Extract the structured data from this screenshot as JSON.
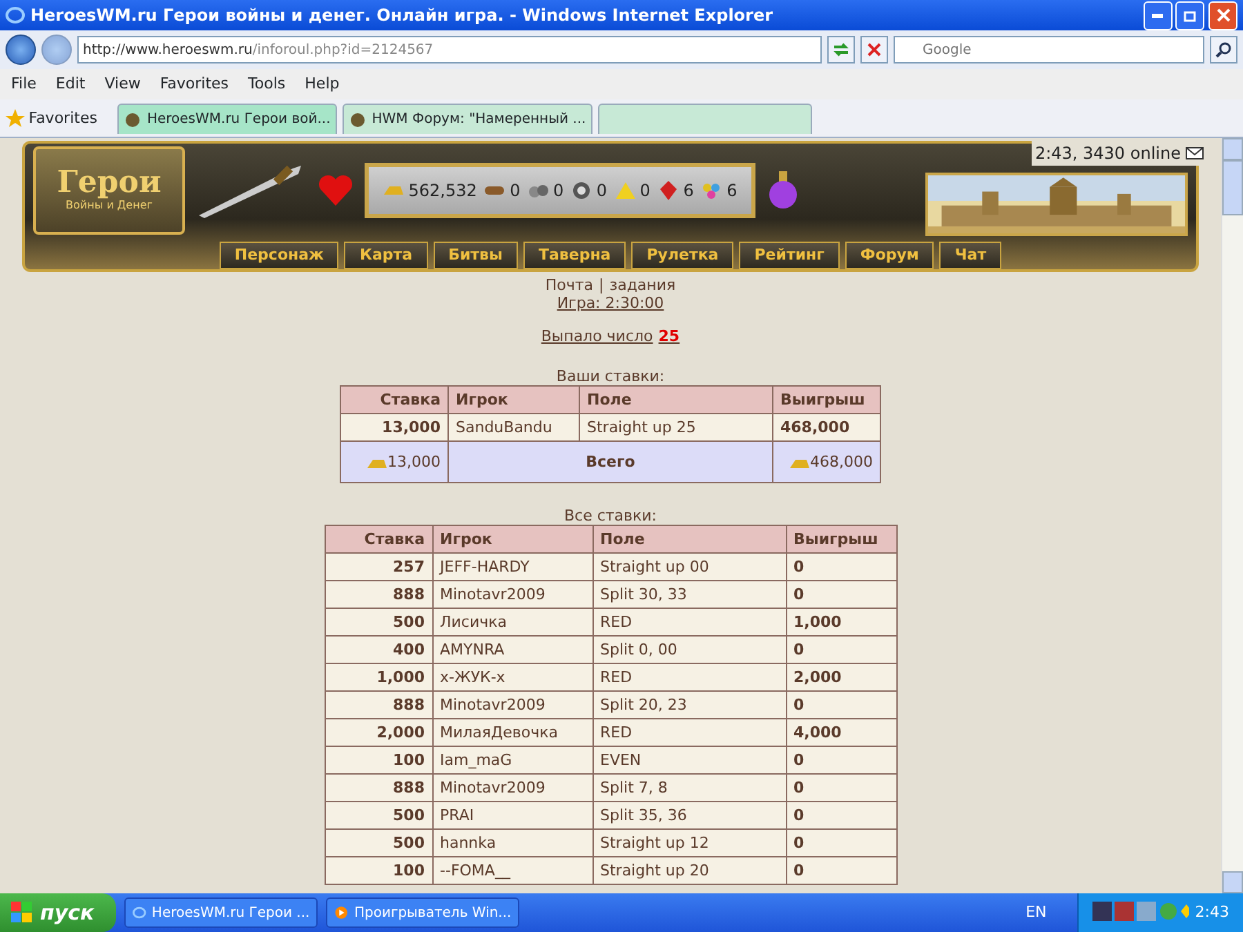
{
  "browser": {
    "title": "HeroesWM.ru Герои войны и денег. Онлайн игра. - Windows Internet Explorer",
    "address_host": "http://www.heroeswm.ru",
    "address_path": "/inforoul.php?id=2124567",
    "search_placeholder": "Google",
    "menu": [
      "File",
      "Edit",
      "View",
      "Favorites",
      "Tools",
      "Help"
    ],
    "favorites_label": "Favorites",
    "tabs": [
      {
        "label": "HeroesWM.ru Герои вой...",
        "selected": true
      },
      {
        "label": "HWM Форум: \"Намеренный ...",
        "selected": false
      }
    ]
  },
  "header": {
    "logo_title": "Герои",
    "logo_subtitle": "Войны и Денег",
    "online": "2:43, 3430 online",
    "resources": [
      {
        "kind": "gold",
        "value": "562,532"
      },
      {
        "kind": "wood",
        "value": "0"
      },
      {
        "kind": "ore",
        "value": "0"
      },
      {
        "kind": "mercury",
        "value": "0"
      },
      {
        "kind": "sulfur",
        "value": "0"
      },
      {
        "kind": "crystal",
        "value": "6"
      },
      {
        "kind": "gems",
        "value": "6"
      }
    ],
    "nav": [
      "Персонаж",
      "Карта",
      "Битвы",
      "Таверна",
      "Рулетка",
      "Рейтинг",
      "Форум",
      "Чат"
    ]
  },
  "links": {
    "mail": "Почта",
    "separator": "|",
    "tasks": "задания",
    "game": "Игра: 2:30:00"
  },
  "result": "Выпало число **25**",
  "my_bets": {
    "caption": "Ваши ставки:",
    "columns": [
      "Ставка",
      "Игрок",
      "Поле",
      "Выигрыш"
    ],
    "rows": [
      [
        "13,000",
        "SanduBandu",
        "Straight up 25",
        "468,000"
      ]
    ],
    "total": {
      "stake": "13,000",
      "label": "Всего",
      "win": "468,000"
    }
  },
  "all_bets": {
    "caption": "Все ставки:",
    "columns": [
      "Ставка",
      "Игрок",
      "Поле",
      "Выигрыш"
    ],
    "rows": [
      [
        "257",
        "JEFF-HARDY",
        "Straight up 00",
        "0"
      ],
      [
        "888",
        "Minotavr2009",
        "Split 30, 33",
        "0"
      ],
      [
        "500",
        "Лисичка",
        "RED",
        "1,000"
      ],
      [
        "400",
        "AMYNRA",
        "Split 0, 00",
        "0"
      ],
      [
        "1,000",
        "x-ЖУК-x",
        "RED",
        "2,000"
      ],
      [
        "888",
        "Minotavr2009",
        "Split 20, 23",
        "0"
      ],
      [
        "2,000",
        "МилаяДевочка",
        "RED",
        "4,000"
      ],
      [
        "100",
        "Iam_maG",
        "EVEN",
        "0"
      ],
      [
        "888",
        "Minotavr2009",
        "Split 7, 8",
        "0"
      ],
      [
        "500",
        "PRAI",
        "Split 35, 36",
        "0"
      ],
      [
        "500",
        "hannka",
        "Straight up 12",
        "0"
      ],
      [
        "100",
        "--FOMA__",
        "Straight up 20",
        "0"
      ]
    ]
  },
  "taskbar": {
    "start": "пуск",
    "items": [
      {
        "label": "HeroesWM.ru Герои ...",
        "selected": false
      },
      {
        "label": "Проигрыватель Win...",
        "selected": false
      }
    ],
    "lang": "EN",
    "clock": "2:43"
  }
}
